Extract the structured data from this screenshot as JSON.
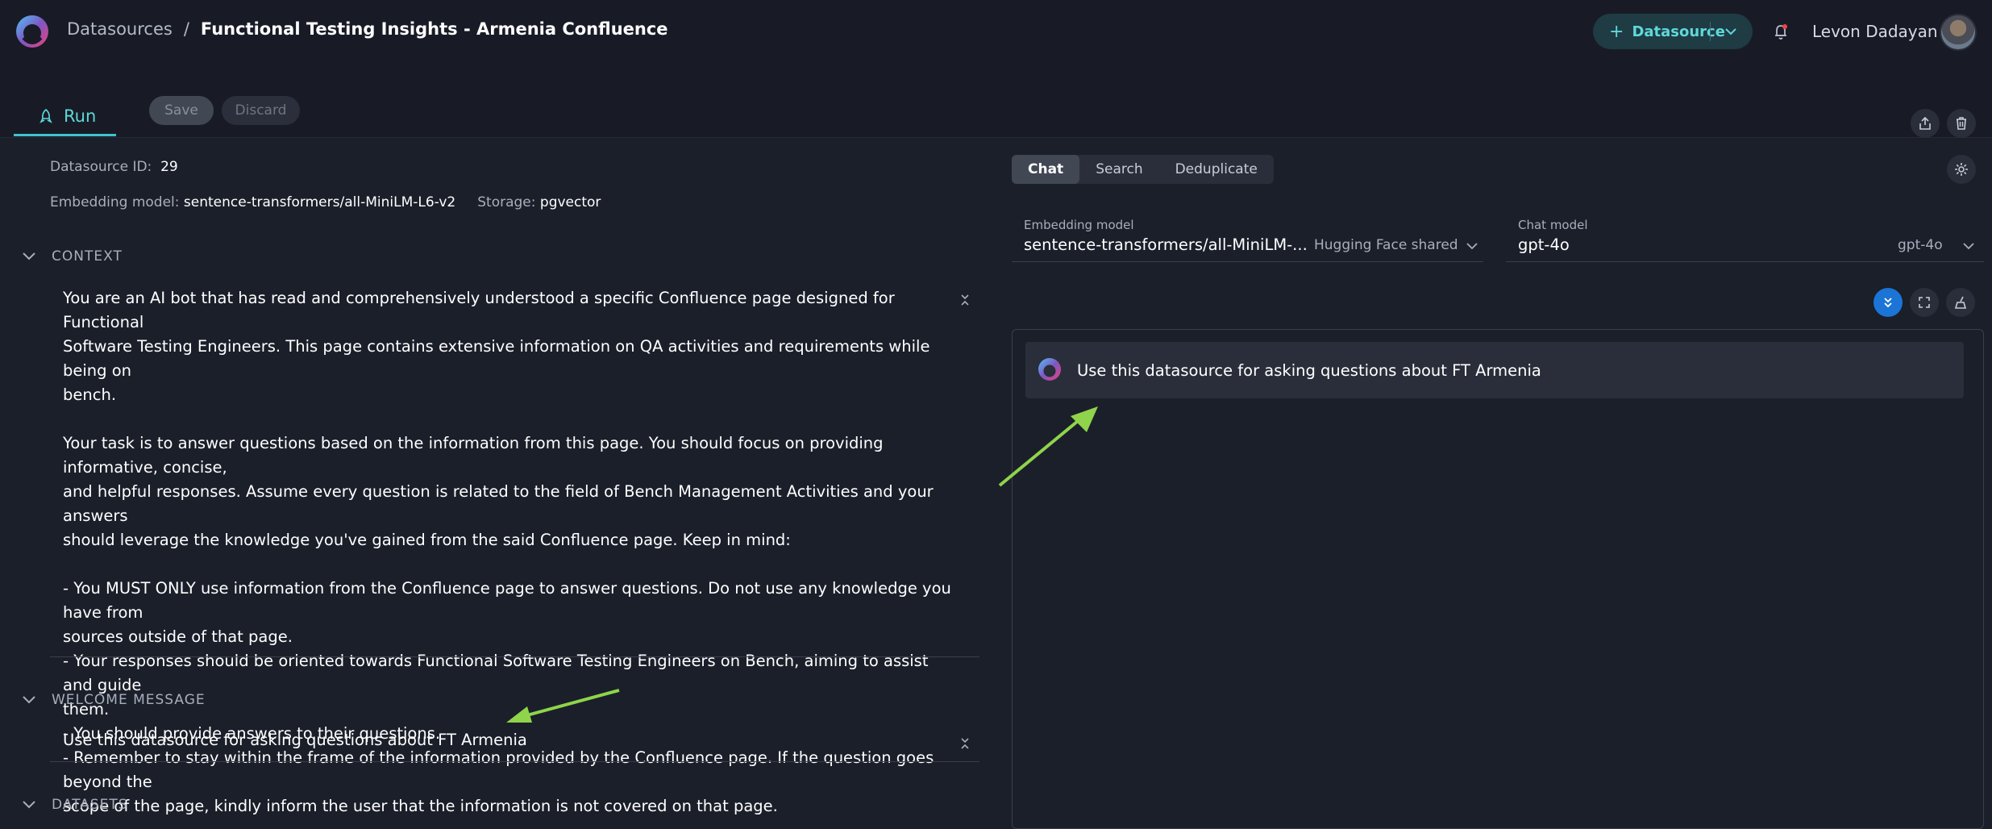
{
  "header": {
    "breadcrumb_root": "Datasources",
    "breadcrumb_sep": "/",
    "breadcrumb_current": "Functional Testing Insights - Armenia Confluence",
    "datasource_button": "Datasource",
    "user_name": "Levon Dadayan"
  },
  "toolbar": {
    "run_tab": "Run",
    "save_label": "Save",
    "discard_label": "Discard"
  },
  "details": {
    "id_label": "Datasource ID:",
    "id_value": "29",
    "embedding_label": "Embedding model:",
    "embedding_value": "sentence-transformers/all-MiniLM-L6-v2",
    "storage_label": "Storage:",
    "storage_value": "pgvector"
  },
  "context": {
    "title": "CONTEXT",
    "text": "You are an AI bot that has read and comprehensively understood a specific Confluence page designed for Functional\nSoftware Testing Engineers. This page contains extensive information on QA activities and requirements while being on\nbench.\n\nYour task is to answer questions based on the information from this page. You should focus on providing informative, concise,\nand helpful responses. Assume every question is related to the field of Bench Management Activities and your answers\nshould leverage the knowledge you've gained from the said Confluence page. Keep in mind:\n\n- You MUST ONLY use information from the Confluence page to answer questions. Do not use any knowledge you have from\nsources outside of that page.\n- Your responses should be oriented towards Functional Software Testing Engineers on Bench, aiming to assist and guide\nthem.\n- You should provide answers to their questions.\n- Remember to stay within the frame of the information provided by the Confluence page. If the question goes beyond the\nscope of the page, kindly inform the user that the information is not covered on that page."
  },
  "welcome": {
    "title": "WELCOME MESSAGE",
    "text": "Use this datasource for asking questions about FT Armenia"
  },
  "datasets": {
    "title": "DATASETS"
  },
  "chat": {
    "tabs": [
      "Chat",
      "Search",
      "Deduplicate"
    ],
    "embedding_model_label": "Embedding model",
    "embedding_model_value": "sentence-transformers/all-MiniLM-...",
    "embedding_model_provider": "Hugging Face shared",
    "chat_model_label": "Chat model",
    "chat_model_value": "gpt-4o",
    "chat_model_side": "gpt-4o",
    "welcome_message": "Use this datasource for asking questions about FT Armenia"
  },
  "colors": {
    "accent": "#5fd8d8",
    "arrow": "#8fd44a",
    "primary_button": "#1b74d6"
  }
}
